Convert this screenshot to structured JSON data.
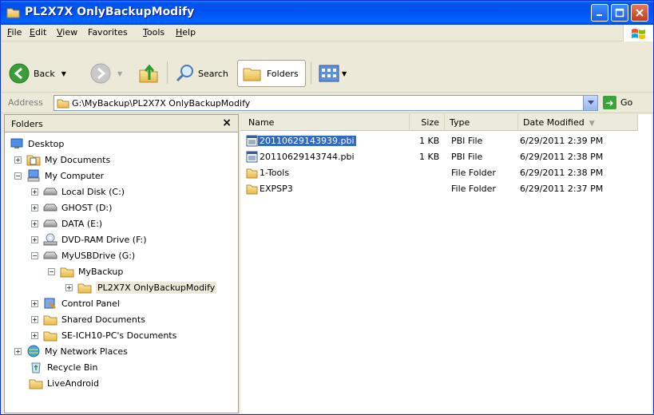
{
  "window": {
    "title": "PL2X7X OnlyBackupModify"
  },
  "menu": [
    {
      "label": "File",
      "u": "F",
      "rest": "ile"
    },
    {
      "label": "Edit",
      "u": "E",
      "rest": "dit"
    },
    {
      "label": "View",
      "u": "V",
      "rest": "iew"
    },
    {
      "label": "Favorites",
      "u": "",
      "rest": "Favorites"
    },
    {
      "label": "Tools",
      "u": "T",
      "rest": "ools"
    },
    {
      "label": "Help",
      "u": "H",
      "rest": "elp"
    }
  ],
  "toolbar": {
    "back": "Back",
    "search": "Search",
    "folders": "Folders"
  },
  "address": {
    "label": "Address",
    "value": "G:\\MyBackup\\PL2X7X OnlyBackupModify",
    "go": "Go"
  },
  "folders_pane": {
    "title": "Folders",
    "tree": [
      {
        "label": "Desktop",
        "icon": "desktop-icon"
      },
      {
        "label": "My Documents",
        "icon": "my-documents-icon"
      },
      {
        "label": "My Computer",
        "icon": "my-computer-icon"
      },
      {
        "label": "Local Disk (C:)",
        "icon": "drive-icon"
      },
      {
        "label": "GHOST (D:)",
        "icon": "drive-icon"
      },
      {
        "label": "DATA (E:)",
        "icon": "drive-icon"
      },
      {
        "label": "DVD-RAM Drive (F:)",
        "icon": "dvd-drive-icon"
      },
      {
        "label": "MyUSBDrive (G:)",
        "icon": "drive-icon"
      },
      {
        "label": "MyBackup",
        "icon": "folder-icon"
      },
      {
        "label": "PL2X7X OnlyBackupModify",
        "icon": "folder-icon"
      },
      {
        "label": "Control Panel",
        "icon": "control-panel-icon"
      },
      {
        "label": "Shared Documents",
        "icon": "folder-icon"
      },
      {
        "label": "SE-ICH10-PC's Documents",
        "icon": "folder-icon"
      },
      {
        "label": "My Network Places",
        "icon": "network-icon"
      },
      {
        "label": "Recycle Bin",
        "icon": "recycle-bin-icon"
      },
      {
        "label": "LiveAndroid",
        "icon": "folder-icon"
      }
    ]
  },
  "file_list": {
    "columns": [
      "Name",
      "Size",
      "Type",
      "Date Modified"
    ],
    "rows": [
      {
        "name": "20110629143939.pbi",
        "size": "1 KB",
        "type": "PBI File",
        "date": "6/29/2011 2:39 PM",
        "icon": "pbi-file-icon"
      },
      {
        "name": "20110629143744.pbi",
        "size": "1 KB",
        "type": "PBI File",
        "date": "6/29/2011 2:38 PM",
        "icon": "pbi-file-icon"
      },
      {
        "name": "1-Tools",
        "size": "",
        "type": "File Folder",
        "date": "6/29/2011 2:38 PM",
        "icon": "folder-icon"
      },
      {
        "name": "EXPSP3",
        "size": "",
        "type": "File Folder",
        "date": "6/29/2011 2:37 PM",
        "icon": "folder-icon"
      }
    ]
  },
  "colors": {
    "titlebar": "#0054e3",
    "selection": "#316ac5",
    "folder": "#f5d67a"
  }
}
